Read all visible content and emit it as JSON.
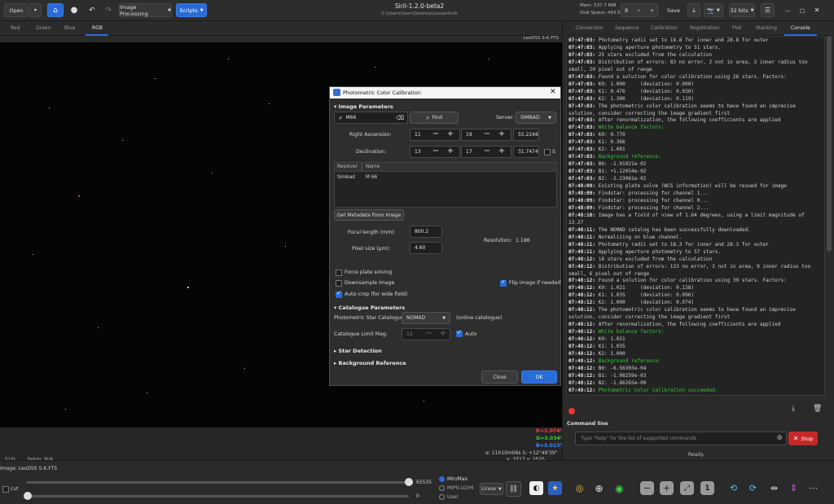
{
  "window": {
    "title": "Siril-1.2.0-beta2",
    "path": "C:\\Users\\User\\Desktop\\Lessarticle"
  },
  "header": {
    "open_label": "Open",
    "image_processing_label": "Image Processing",
    "scripts_label": "Scripts",
    "mem": "Mem: 537.7 MiB",
    "disk": "Disk Space: 493.5 GiB",
    "spin_value": "8",
    "save_label": "Save",
    "bits_label": "32 bits"
  },
  "channel_tabs": [
    "Red",
    "Green",
    "Blue",
    "RGB"
  ],
  "image_filename_top": "LeoDSS S-K.FTS",
  "right_tabs": [
    "Conversion",
    "Sequence",
    "Calibration",
    "Registration",
    "Plot",
    "Stacking",
    "Console"
  ],
  "dialog": {
    "title": "Photometric Color Calibration",
    "image_params_header": "Image Parameters",
    "search_value": "M66",
    "find_label": "Find",
    "server_label": "Server:",
    "server_value": "SIMBAD",
    "ra_label": "Right Ascension:",
    "ra_h": "11",
    "ra_m": "19",
    "ra_s": "55.2248",
    "dec_label": "Declination:",
    "dec_d": "13",
    "dec_m": "17",
    "dec_s": "31.7474",
    "south_label": "S",
    "resolver_col": "Resolver",
    "name_col": "Name",
    "resolver_val": "Simbad",
    "name_val": "M 66",
    "get_metadata_label": "Get Metadata From Image",
    "focal_label": "Focal length (mm):",
    "focal_value": "800.2",
    "pixel_label": "Pixel size (µm):",
    "pixel_value": "4.60",
    "resolution_label": "Resolution:",
    "resolution_value": "1.186",
    "force_plate_label": "Force plate solving",
    "downsample_label": "Downsample image",
    "flip_label": "Flip image if needed",
    "autocrop_label": "Auto-crop (for wide field)",
    "catalogue_header": "Catalogue Parameters",
    "phot_cat_label": "Photometric Star Catalogue:",
    "phot_cat_value": "NOMAD",
    "online_label": "(online catalogue)",
    "limit_mag_label": "Catalogue Limit Mag:",
    "limit_mag_value": "12",
    "auto_label": "Auto",
    "star_detection_header": "Star Detection",
    "background_ref_header": "Background Reference",
    "close_label": "Close",
    "ok_label": "OK"
  },
  "console": {
    "lines": [
      {
        "t": "07:47:03:",
        "m": "Photometry radii set to 18.8 for inner and 28.8 for outer",
        "c": ""
      },
      {
        "t": "07:47:03:",
        "m": "Applying aperture photometry to 51 stars.",
        "c": ""
      },
      {
        "t": "07:47:03:",
        "m": "25 stars excluded from the calculation",
        "c": ""
      },
      {
        "t": "07:47:03:",
        "m": "Distribution of errors: 83 no error, 2 not in area, 3 inner radius too",
        "c": ""
      },
      {
        "t": "",
        "m": "small, 20 pixel out of range",
        "c": ""
      },
      {
        "t": "07:47:03:",
        "m": "Found a solution for color calibration using 26 stars. Factors:",
        "c": ""
      },
      {
        "t": "07:47:03:",
        "m": "K0: 1.000     (deviation: 0.000)",
        "c": ""
      },
      {
        "t": "07:47:03:",
        "m": "K1: 0.476     (deviation: 0.030)",
        "c": ""
      },
      {
        "t": "07:47:03:",
        "m": "K2: 1.300     (deviation: 0.119)",
        "c": ""
      },
      {
        "t": "07:47:03:",
        "m": "The photometric color calibration seems to have found an imprecise",
        "c": ""
      },
      {
        "t": "",
        "m": "solution, consider correcting the image gradient first",
        "c": ""
      },
      {
        "t": "07:47:03:",
        "m": "After renormalization, the following coefficients are applied",
        "c": ""
      },
      {
        "t": "07:47:03:",
        "m": "White balance factors:",
        "c": "green"
      },
      {
        "t": "07:47:03:",
        "m": "K0: 0.770",
        "c": ""
      },
      {
        "t": "07:47:03:",
        "m": "K1: 0.366",
        "c": ""
      },
      {
        "t": "07:47:03:",
        "m": "K2: 1.001",
        "c": ""
      },
      {
        "t": "07:47:03:",
        "m": "Background reference:",
        "c": "green"
      },
      {
        "t": "07:47:03:",
        "m": "B0: -1.01021e-02",
        "c": ""
      },
      {
        "t": "07:47:03:",
        "m": "B1: +1.12054e-02",
        "c": ""
      },
      {
        "t": "07:47:03:",
        "m": "B2: -2.23061e-02",
        "c": ""
      },
      {
        "t": "07:48:09:",
        "m": "Existing plate solve (WCS information) will be resued for image",
        "c": ""
      },
      {
        "t": "07:48:09:",
        "m": "Findstar: processing for channel 1...",
        "c": ""
      },
      {
        "t": "07:48:09:",
        "m": "Findstar: processing for channel 0...",
        "c": ""
      },
      {
        "t": "07:48:09:",
        "m": "Findstar: processing for channel 2...",
        "c": ""
      },
      {
        "t": "07:48:10:",
        "m": "Image has a field of view of 1.64 degrees, using a limit magnitude of",
        "c": ""
      },
      {
        "t": "",
        "m": "13.27",
        "c": ""
      },
      {
        "t": "07:48:11:",
        "m": "The NOMAD catalog has been successfully downloaded.",
        "c": ""
      },
      {
        "t": "07:48:11:",
        "m": "Normalizing on blue channel.",
        "c": ""
      },
      {
        "t": "07:48:11:",
        "m": "Photometry radii set to 18.3 for inner and 28.3 for outer",
        "c": ""
      },
      {
        "t": "07:48:11:",
        "m": "Applying aperture photometry to 57 stars.",
        "c": ""
      },
      {
        "t": "07:48:12:",
        "m": "18 stars excluded from the calculation",
        "c": ""
      },
      {
        "t": "07:48:12:",
        "m": "Distribution of errors: 133 no error, 3 not in area, 9 inner radius too",
        "c": ""
      },
      {
        "t": "",
        "m": "small, 6 pixel out of range",
        "c": ""
      },
      {
        "t": "07:48:12:",
        "m": "Found a solution for color calibration using 39 stars. Factors:",
        "c": ""
      },
      {
        "t": "07:48:12:",
        "m": "K0: 1.021     (deviation: 0.138)",
        "c": ""
      },
      {
        "t": "07:48:12:",
        "m": "K1: 1.035     (deviation: 0.096)",
        "c": ""
      },
      {
        "t": "07:48:12:",
        "m": "K2: 1.000     (deviation: 0.074)",
        "c": ""
      },
      {
        "t": "07:48:12:",
        "m": "The photometric color calibration seems to have found an imprecise",
        "c": ""
      },
      {
        "t": "",
        "m": "solution, consider correcting the image gradient first",
        "c": ""
      },
      {
        "t": "07:48:12:",
        "m": "After renormalization, the following coefficients are applied",
        "c": ""
      },
      {
        "t": "07:48:12:",
        "m": "White balance factors:",
        "c": "green"
      },
      {
        "t": "07:48:12:",
        "m": "K0: 1.021",
        "c": ""
      },
      {
        "t": "07:48:12:",
        "m": "K1: 1.035",
        "c": ""
      },
      {
        "t": "07:48:12:",
        "m": "K2: 1.000",
        "c": ""
      },
      {
        "t": "07:48:12:",
        "m": "Background reference:",
        "c": "green"
      },
      {
        "t": "07:48:12:",
        "m": "B0: -6.56303e-04",
        "c": ""
      },
      {
        "t": "07:48:12:",
        "m": "B1: -1.08259e-03",
        "c": ""
      },
      {
        "t": "07:48:12:",
        "m": "B2: -1.86265e-09",
        "c": ""
      },
      {
        "t": "07:48:12:",
        "m": "Photometric Color Calibration succeeded.",
        "c": "green"
      }
    ]
  },
  "command_line": {
    "label": "Command line",
    "placeholder": "Type \"help\" for the list of supported commands",
    "stop_label": "Stop",
    "status": "Ready."
  },
  "statusbar": {
    "zoom": "51%",
    "fwhm": "fwhm: N/A",
    "r_val": "R=3.074%",
    "g_val": "G=3.034%",
    "b_val": "B=3.013%",
    "coords": "α: 11h10m06s  δ: +12°49'39\"",
    "xy": "x: 3717  y: 2525",
    "image_label": "Image: LeoDSS S-K.FTS"
  },
  "bottom": {
    "cut_label": "cut",
    "hi_value": "65535",
    "lo_value": "0",
    "minmax_label": "Min/Max",
    "mips_label": "MIPS-LO/HI",
    "user_label": "User",
    "linear_label": "Linear"
  },
  "colors": {
    "accent": "#2a6cd6",
    "stop": "#c62828",
    "console_green": "#37c837"
  }
}
